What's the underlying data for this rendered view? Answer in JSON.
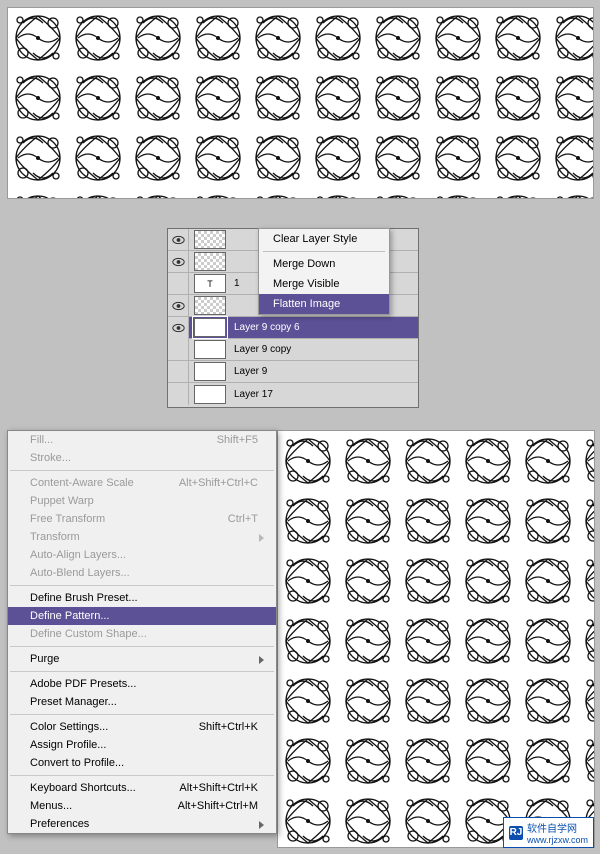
{
  "layers": {
    "rows": [
      {
        "name": "",
        "type": "fx"
      },
      {
        "name": "",
        "type": "fx"
      },
      {
        "name": "1",
        "type": "txt"
      },
      {
        "name": "",
        "type": "fx"
      },
      {
        "name": "Layer 9 copy 6",
        "type": "sel"
      },
      {
        "name": "Layer 9 copy",
        "type": "n"
      },
      {
        "name": "Layer 9",
        "type": "n"
      },
      {
        "name": "Layer 17",
        "type": "bg"
      }
    ]
  },
  "layerContext": {
    "items": [
      {
        "label": "Clear Layer Style",
        "hl": false
      },
      {
        "label": "Merge Down",
        "hl": false,
        "sepAfter": true
      },
      {
        "label": "Merge Visible",
        "hl": false
      },
      {
        "label": "Flatten Image",
        "hl": true
      }
    ]
  },
  "editMenu": {
    "items": [
      {
        "label": "Fill...",
        "short": "Shift+F5",
        "dis": true
      },
      {
        "label": "Stroke...",
        "short": "",
        "dis": true,
        "sepAfter": true
      },
      {
        "label": "Content-Aware Scale",
        "short": "Alt+Shift+Ctrl+C",
        "dis": true
      },
      {
        "label": "Puppet Warp",
        "short": "",
        "dis": true
      },
      {
        "label": "Free Transform",
        "short": "Ctrl+T",
        "dis": true
      },
      {
        "label": "Transform",
        "short": "",
        "dis": true,
        "arrow": true
      },
      {
        "label": "Auto-Align Layers...",
        "short": "",
        "dis": true
      },
      {
        "label": "Auto-Blend Layers...",
        "short": "",
        "dis": true,
        "sepAfter": true
      },
      {
        "label": "Define Brush Preset...",
        "short": "",
        "dis": false
      },
      {
        "label": "Define Pattern...",
        "short": "",
        "dis": false,
        "hl": true
      },
      {
        "label": "Define Custom Shape...",
        "short": "",
        "dis": true,
        "sepAfter": true
      },
      {
        "label": "Purge",
        "short": "",
        "dis": false,
        "arrow": true,
        "sepAfter": true
      },
      {
        "label": "Adobe PDF Presets...",
        "short": "",
        "dis": false
      },
      {
        "label": "Preset Manager...",
        "short": "",
        "dis": false,
        "sepAfter": true
      },
      {
        "label": "Color Settings...",
        "short": "Shift+Ctrl+K",
        "dis": false
      },
      {
        "label": "Assign Profile...",
        "short": "",
        "dis": false
      },
      {
        "label": "Convert to Profile...",
        "short": "",
        "dis": false,
        "sepAfter": true
      },
      {
        "label": "Keyboard Shortcuts...",
        "short": "Alt+Shift+Ctrl+K",
        "dis": false
      },
      {
        "label": "Menus...",
        "short": "Alt+Shift+Ctrl+M",
        "dis": false
      },
      {
        "label": "Preferences",
        "short": "",
        "dis": false,
        "arrow": true
      }
    ]
  },
  "watermark": {
    "logo": "RJ",
    "text1": "软件自学网",
    "text2": "www.rjzxw.com"
  }
}
